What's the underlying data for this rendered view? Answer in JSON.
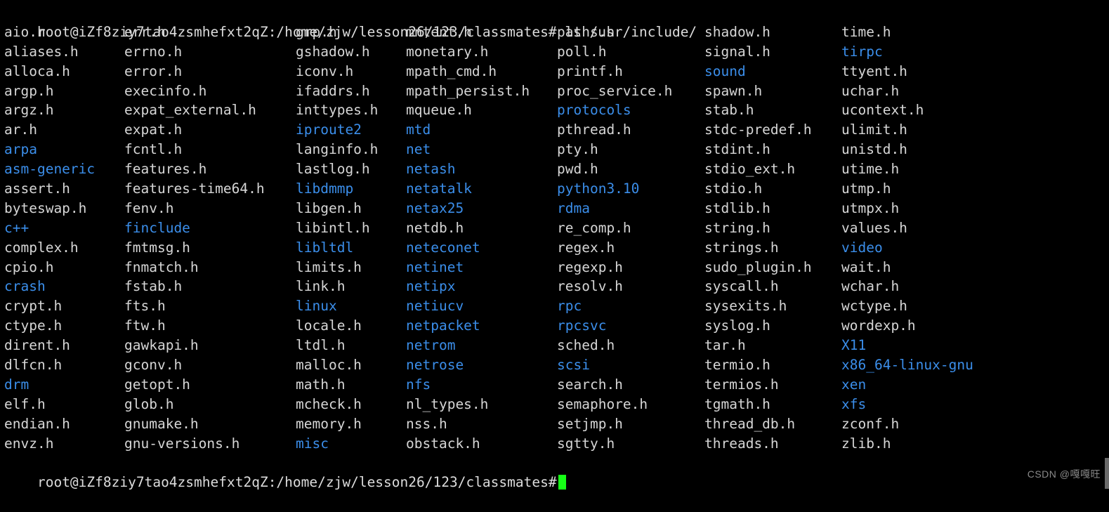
{
  "terminal": {
    "background_color": "#000000",
    "file_color": "#d6d6d6",
    "dir_color": "#3b8eea",
    "cursor_color": "#16ff16",
    "command_line": "root@iZf8ziy7tao4zsmhefxt2qZ:/home/zjw/lesson26/123/classmates# ls /usr/include/",
    "final_prompt": "root@iZf8ziy7tao4zsmhefxt2qZ:/home/zjw/lesson26/123/classmates#",
    "user_host": "root@iZf8ziy7tao4zsmhefxt2qZ",
    "cwd": "/home/zjw/lesson26/123/classmates",
    "prompt_symbol": "#",
    "command": "ls /usr/include/",
    "cursor": "block"
  },
  "watermark": {
    "text": "CSDN @嘎嘎旺"
  },
  "listing": {
    "columns": 7,
    "rows": 22,
    "entries": [
      [
        {
          "name": "aio.h",
          "type": "file"
        },
        {
          "name": "err.h",
          "type": "file"
        },
        {
          "name": "grp.h",
          "type": "file"
        },
        {
          "name": "mntent.h",
          "type": "file"
        },
        {
          "name": "paths.h",
          "type": "file"
        },
        {
          "name": "shadow.h",
          "type": "file"
        },
        {
          "name": "time.h",
          "type": "file"
        }
      ],
      [
        {
          "name": "aliases.h",
          "type": "file"
        },
        {
          "name": "errno.h",
          "type": "file"
        },
        {
          "name": "gshadow.h",
          "type": "file"
        },
        {
          "name": "monetary.h",
          "type": "file"
        },
        {
          "name": "poll.h",
          "type": "file"
        },
        {
          "name": "signal.h",
          "type": "file"
        },
        {
          "name": "tirpc",
          "type": "dir"
        }
      ],
      [
        {
          "name": "alloca.h",
          "type": "file"
        },
        {
          "name": "error.h",
          "type": "file"
        },
        {
          "name": "iconv.h",
          "type": "file"
        },
        {
          "name": "mpath_cmd.h",
          "type": "file"
        },
        {
          "name": "printf.h",
          "type": "file"
        },
        {
          "name": "sound",
          "type": "dir"
        },
        {
          "name": "ttyent.h",
          "type": "file"
        }
      ],
      [
        {
          "name": "argp.h",
          "type": "file"
        },
        {
          "name": "execinfo.h",
          "type": "file"
        },
        {
          "name": "ifaddrs.h",
          "type": "file"
        },
        {
          "name": "mpath_persist.h",
          "type": "file"
        },
        {
          "name": "proc_service.h",
          "type": "file"
        },
        {
          "name": "spawn.h",
          "type": "file"
        },
        {
          "name": "uchar.h",
          "type": "file"
        }
      ],
      [
        {
          "name": "argz.h",
          "type": "file"
        },
        {
          "name": "expat_external.h",
          "type": "file"
        },
        {
          "name": "inttypes.h",
          "type": "file"
        },
        {
          "name": "mqueue.h",
          "type": "file"
        },
        {
          "name": "protocols",
          "type": "dir"
        },
        {
          "name": "stab.h",
          "type": "file"
        },
        {
          "name": "ucontext.h",
          "type": "file"
        }
      ],
      [
        {
          "name": "ar.h",
          "type": "file"
        },
        {
          "name": "expat.h",
          "type": "file"
        },
        {
          "name": "iproute2",
          "type": "dir"
        },
        {
          "name": "mtd",
          "type": "dir"
        },
        {
          "name": "pthread.h",
          "type": "file"
        },
        {
          "name": "stdc-predef.h",
          "type": "file"
        },
        {
          "name": "ulimit.h",
          "type": "file"
        }
      ],
      [
        {
          "name": "arpa",
          "type": "dir"
        },
        {
          "name": "fcntl.h",
          "type": "file"
        },
        {
          "name": "langinfo.h",
          "type": "file"
        },
        {
          "name": "net",
          "type": "dir"
        },
        {
          "name": "pty.h",
          "type": "file"
        },
        {
          "name": "stdint.h",
          "type": "file"
        },
        {
          "name": "unistd.h",
          "type": "file"
        }
      ],
      [
        {
          "name": "asm-generic",
          "type": "dir"
        },
        {
          "name": "features.h",
          "type": "file"
        },
        {
          "name": "lastlog.h",
          "type": "file"
        },
        {
          "name": "netash",
          "type": "dir"
        },
        {
          "name": "pwd.h",
          "type": "file"
        },
        {
          "name": "stdio_ext.h",
          "type": "file"
        },
        {
          "name": "utime.h",
          "type": "file"
        }
      ],
      [
        {
          "name": "assert.h",
          "type": "file"
        },
        {
          "name": "features-time64.h",
          "type": "file"
        },
        {
          "name": "libdmmp",
          "type": "dir"
        },
        {
          "name": "netatalk",
          "type": "dir"
        },
        {
          "name": "python3.10",
          "type": "dir"
        },
        {
          "name": "stdio.h",
          "type": "file"
        },
        {
          "name": "utmp.h",
          "type": "file"
        }
      ],
      [
        {
          "name": "byteswap.h",
          "type": "file"
        },
        {
          "name": "fenv.h",
          "type": "file"
        },
        {
          "name": "libgen.h",
          "type": "file"
        },
        {
          "name": "netax25",
          "type": "dir"
        },
        {
          "name": "rdma",
          "type": "dir"
        },
        {
          "name": "stdlib.h",
          "type": "file"
        },
        {
          "name": "utmpx.h",
          "type": "file"
        }
      ],
      [
        {
          "name": "c++",
          "type": "dir"
        },
        {
          "name": "finclude",
          "type": "dir"
        },
        {
          "name": "libintl.h",
          "type": "file"
        },
        {
          "name": "netdb.h",
          "type": "file"
        },
        {
          "name": "re_comp.h",
          "type": "file"
        },
        {
          "name": "string.h",
          "type": "file"
        },
        {
          "name": "values.h",
          "type": "file"
        }
      ],
      [
        {
          "name": "complex.h",
          "type": "file"
        },
        {
          "name": "fmtmsg.h",
          "type": "file"
        },
        {
          "name": "libltdl",
          "type": "dir"
        },
        {
          "name": "neteconet",
          "type": "dir"
        },
        {
          "name": "regex.h",
          "type": "file"
        },
        {
          "name": "strings.h",
          "type": "file"
        },
        {
          "name": "video",
          "type": "dir"
        }
      ],
      [
        {
          "name": "cpio.h",
          "type": "file"
        },
        {
          "name": "fnmatch.h",
          "type": "file"
        },
        {
          "name": "limits.h",
          "type": "file"
        },
        {
          "name": "netinet",
          "type": "dir"
        },
        {
          "name": "regexp.h",
          "type": "file"
        },
        {
          "name": "sudo_plugin.h",
          "type": "file"
        },
        {
          "name": "wait.h",
          "type": "file"
        }
      ],
      [
        {
          "name": "crash",
          "type": "dir"
        },
        {
          "name": "fstab.h",
          "type": "file"
        },
        {
          "name": "link.h",
          "type": "file"
        },
        {
          "name": "netipx",
          "type": "dir"
        },
        {
          "name": "resolv.h",
          "type": "file"
        },
        {
          "name": "syscall.h",
          "type": "file"
        },
        {
          "name": "wchar.h",
          "type": "file"
        }
      ],
      [
        {
          "name": "crypt.h",
          "type": "file"
        },
        {
          "name": "fts.h",
          "type": "file"
        },
        {
          "name": "linux",
          "type": "dir"
        },
        {
          "name": "netiucv",
          "type": "dir"
        },
        {
          "name": "rpc",
          "type": "dir"
        },
        {
          "name": "sysexits.h",
          "type": "file"
        },
        {
          "name": "wctype.h",
          "type": "file"
        }
      ],
      [
        {
          "name": "ctype.h",
          "type": "file"
        },
        {
          "name": "ftw.h",
          "type": "file"
        },
        {
          "name": "locale.h",
          "type": "file"
        },
        {
          "name": "netpacket",
          "type": "dir"
        },
        {
          "name": "rpcsvc",
          "type": "dir"
        },
        {
          "name": "syslog.h",
          "type": "file"
        },
        {
          "name": "wordexp.h",
          "type": "file"
        }
      ],
      [
        {
          "name": "dirent.h",
          "type": "file"
        },
        {
          "name": "gawkapi.h",
          "type": "file"
        },
        {
          "name": "ltdl.h",
          "type": "file"
        },
        {
          "name": "netrom",
          "type": "dir"
        },
        {
          "name": "sched.h",
          "type": "file"
        },
        {
          "name": "tar.h",
          "type": "file"
        },
        {
          "name": "X11",
          "type": "dir"
        }
      ],
      [
        {
          "name": "dlfcn.h",
          "type": "file"
        },
        {
          "name": "gconv.h",
          "type": "file"
        },
        {
          "name": "malloc.h",
          "type": "file"
        },
        {
          "name": "netrose",
          "type": "dir"
        },
        {
          "name": "scsi",
          "type": "dir"
        },
        {
          "name": "termio.h",
          "type": "file"
        },
        {
          "name": "x86_64-linux-gnu",
          "type": "dir"
        }
      ],
      [
        {
          "name": "drm",
          "type": "dir"
        },
        {
          "name": "getopt.h",
          "type": "file"
        },
        {
          "name": "math.h",
          "type": "file"
        },
        {
          "name": "nfs",
          "type": "dir"
        },
        {
          "name": "search.h",
          "type": "file"
        },
        {
          "name": "termios.h",
          "type": "file"
        },
        {
          "name": "xen",
          "type": "dir"
        }
      ],
      [
        {
          "name": "elf.h",
          "type": "file"
        },
        {
          "name": "glob.h",
          "type": "file"
        },
        {
          "name": "mcheck.h",
          "type": "file"
        },
        {
          "name": "nl_types.h",
          "type": "file"
        },
        {
          "name": "semaphore.h",
          "type": "file"
        },
        {
          "name": "tgmath.h",
          "type": "file"
        },
        {
          "name": "xfs",
          "type": "dir"
        }
      ],
      [
        {
          "name": "endian.h",
          "type": "file"
        },
        {
          "name": "gnumake.h",
          "type": "file"
        },
        {
          "name": "memory.h",
          "type": "file"
        },
        {
          "name": "nss.h",
          "type": "file"
        },
        {
          "name": "setjmp.h",
          "type": "file"
        },
        {
          "name": "thread_db.h",
          "type": "file"
        },
        {
          "name": "zconf.h",
          "type": "file"
        }
      ],
      [
        {
          "name": "envz.h",
          "type": "file"
        },
        {
          "name": "gnu-versions.h",
          "type": "file"
        },
        {
          "name": "misc",
          "type": "dir"
        },
        {
          "name": "obstack.h",
          "type": "file"
        },
        {
          "name": "sgtty.h",
          "type": "file"
        },
        {
          "name": "threads.h",
          "type": "file"
        },
        {
          "name": "zlib.h",
          "type": "file"
        }
      ]
    ]
  }
}
